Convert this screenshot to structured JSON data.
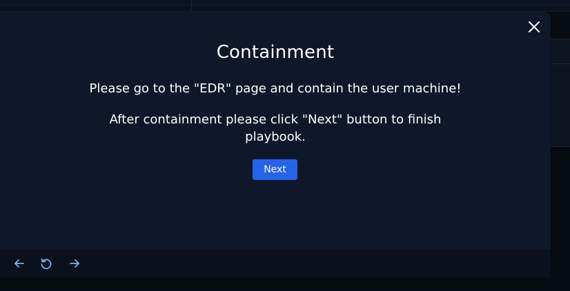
{
  "modal": {
    "title": "Containment",
    "message_1": "Please go to the \"EDR\" page and contain the user machine!",
    "message_2": "After containment please click \"Next\" button to finish playbook.",
    "next_label": "Next",
    "close_icon": "close-icon"
  },
  "footer": {
    "icons": [
      "arrow-left-icon",
      "refresh-icon",
      "arrow-right-icon"
    ]
  },
  "colors": {
    "modal_bg": "#0f1828",
    "page_bg": "#070b12",
    "accent": "#2563eb",
    "icon": "#7fb2e5",
    "text": "#ffffff"
  }
}
